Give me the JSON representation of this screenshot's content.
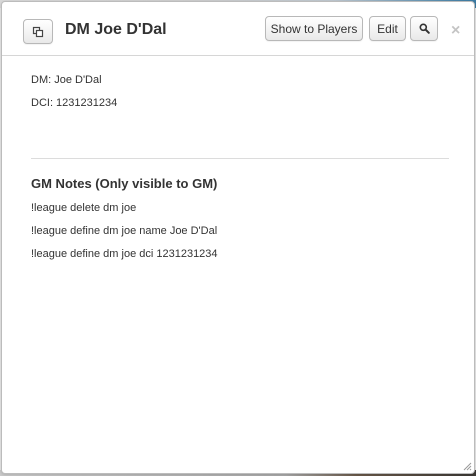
{
  "dialog": {
    "title": "DM Joe D'Dal",
    "buttons": {
      "show_to_players": "Show to Players",
      "edit": "Edit",
      "close": "×"
    },
    "icons": {
      "popout": "popout-icon",
      "search": "magnifier-icon",
      "resize": "resize-grip-icon"
    }
  },
  "bio": {
    "lines": [
      "DM: Joe D'Dal",
      "DCI: 1231231234"
    ]
  },
  "gm_notes": {
    "heading": "GM Notes (Only visible to GM)",
    "lines": [
      "!league delete dm joe",
      "!league define dm joe name Joe D'Dal",
      "!league define dm joe dci 1231231234"
    ]
  }
}
